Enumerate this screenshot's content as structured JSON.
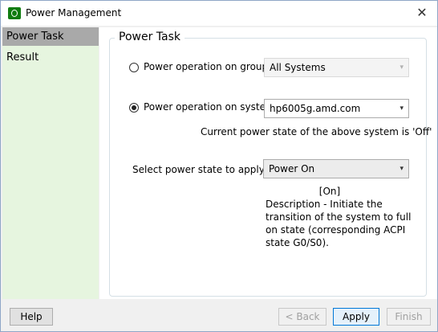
{
  "window": {
    "title": "Power Management",
    "close": "✕"
  },
  "sidebar": {
    "items": [
      {
        "label": "Power Task",
        "selected": true
      },
      {
        "label": "Result",
        "selected": false
      }
    ]
  },
  "panel": {
    "title": "Power Task",
    "group_option": {
      "label": "Power operation on group",
      "checked": false,
      "value": "All Systems",
      "enabled": false
    },
    "system_option": {
      "label": "Power operation on system",
      "checked": true,
      "value": "hp6005g.amd.com"
    },
    "current_state_text": "Current power state of the above system is 'Off'",
    "apply_state": {
      "label": "Select power state to apply",
      "value": "Power On"
    },
    "description": {
      "state": "[On]",
      "text": "Description - Initiate the transition of the system to full on state (corresponding ACPI state G0/S0)."
    }
  },
  "footer": {
    "help": "Help",
    "back": "< Back",
    "apply": "Apply",
    "finish": "Finish"
  },
  "icons": {
    "dropdown": "▾",
    "app": "power-management-app-icon"
  },
  "colors": {
    "sidebar_bg": "#e6f5df",
    "selected_item": "#a9a9a9",
    "primary_border": "#0078d7"
  }
}
